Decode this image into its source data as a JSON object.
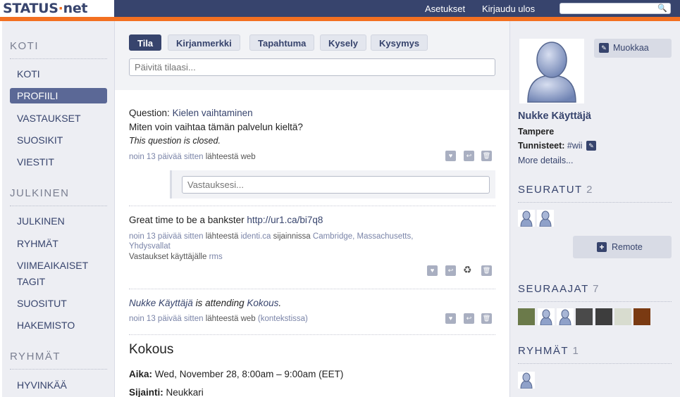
{
  "header": {
    "logo_status": "STATUS",
    "logo_dot": "·",
    "logo_net": "net",
    "settings": "Asetukset",
    "logout": "Kirjaudu ulos",
    "search_placeholder": ""
  },
  "nav": {
    "home_heading": "KOTI",
    "home_items": [
      "KOTI",
      "PROFIILI",
      "VASTAUKSET",
      "SUOSIKIT",
      "VIESTIT"
    ],
    "public_heading": "JULKINEN",
    "public_items": [
      "JULKINEN",
      "RYHMÄT",
      "VIIMEAIKAISET",
      "TAGIT",
      "SUOSITUT",
      "HAKEMISTO"
    ],
    "groups_heading": "RYHMÄT",
    "groups_items": [
      "HYVINKÄÄ"
    ]
  },
  "composer": {
    "tabs": [
      "Tila",
      "Kirjanmerkki",
      "Tapahtuma",
      "Kysely",
      "Kysymys"
    ],
    "status_placeholder": "Päivitä tilaasi..."
  },
  "notices": {
    "q_prefix": "Question:",
    "q_title": "Kielen vaihtaminen",
    "q_text": "Miten voin vaihtaa tämän palvelun kieltä?",
    "q_closed": "This question is closed.",
    "q_time": "noin 13 päivää sitten",
    "q_source_prefix": "lähteestä",
    "q_source": "web",
    "answer_placeholder": "Vastauksesi...",
    "n2_text": "Great time to be a bankster",
    "n2_link": "http://ur1.ca/bi7q8",
    "n2_time": "noin 13 päivää sitten",
    "n2_source_prefix": "lähteestä",
    "n2_source": "identi.ca",
    "n2_location_prefix": "sijainnissa",
    "n2_location1": "Cambridge, Massachusetts,",
    "n2_location2": "Yhdysvallat",
    "n2_reply_prefix": "Vastaukset käyttäjälle",
    "n2_reply_user": "rms",
    "n3_user": "Nukke Käyttäjä",
    "n3_mid": "is attending",
    "n3_event": "Kokous",
    "n3_end": ".",
    "n3_time": "noin 13 päivää sitten",
    "n3_source_prefix": "lähteestä",
    "n3_source": "web",
    "n3_context": "(kontekstissa)",
    "event_title": "Kokous",
    "time_label": "Aika:",
    "time_value": "Wed, November 28, 8:00am – 9:00am (EET)",
    "place_label": "Sijainti:",
    "place_value": "Neukkari"
  },
  "sidebar": {
    "edit": "Muokkaa",
    "name": "Nukke Käyttäjä",
    "location": "Tampere",
    "tags_label": "Tunnisteet:",
    "tag": "#wii",
    "more": "More details...",
    "following_heading": "SEURATUT",
    "following_count": "2",
    "remote": "Remote",
    "followers_heading": "SEURAAJAT",
    "followers_count": "7",
    "groups_heading": "RYHMÄT",
    "groups_count": "1"
  },
  "colors": {
    "brand_dark": "#37446d",
    "brand_orange": "#f37021",
    "active_nav": "#5b6896"
  }
}
